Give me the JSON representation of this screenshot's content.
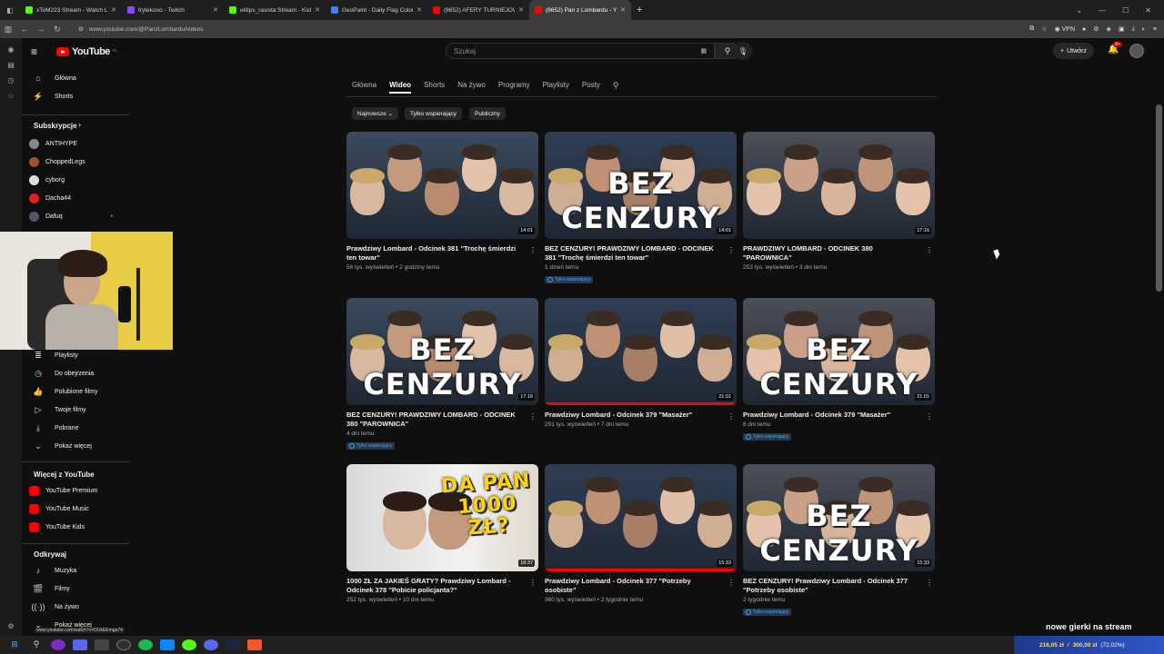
{
  "browser": {
    "tabs": [
      {
        "title": "xToM223 Stream - Watch Li",
        "color": "#53fc18",
        "active": false
      },
      {
        "title": "frytekooo - Twitch",
        "color": "#9146ff",
        "active": false
      },
      {
        "title": "eklips_rasista Stream - Kick",
        "color": "#53fc18",
        "active": false
      },
      {
        "title": "GeoPaint - Daily Flag Color Ga",
        "color": "#3b82f6",
        "active": false
      },
      {
        "title": "(8652) AFERY TURNIEJOWE! M",
        "color": "#ff0000",
        "active": false
      },
      {
        "title": "(8652) Pan z Lombardu - YouTu",
        "color": "#ff0000",
        "active": true
      }
    ],
    "new_tab": "+",
    "url": "www.youtube.com/@PanzLombardu/videos",
    "vpn_label": "VPN"
  },
  "youtube": {
    "logo_text": "YouTube",
    "logo_suffix": "PL",
    "search_placeholder": "Szukaj",
    "create_label": "Utwórz",
    "notif_count": "9+",
    "sidebar": {
      "main": [
        {
          "label": "Główna",
          "icon": "home-icon"
        },
        {
          "label": "Shorts",
          "icon": "shorts-icon"
        }
      ],
      "subs_header": "Subskrypcje",
      "subs": [
        {
          "label": "ANTIHYPE",
          "color": "#888888"
        },
        {
          "label": "ChoppedLegs",
          "color": "#a0522d"
        },
        {
          "label": "cyborg",
          "color": "#dddddd"
        },
        {
          "label": "Dacha44",
          "color": "#d22"
        },
        {
          "label": "Dafuq",
          "color": "#556"
        }
      ],
      "you": [
        {
          "label": "Playlisty",
          "icon": "playlist-icon"
        },
        {
          "label": "Do obejrzenia",
          "icon": "clock-icon"
        },
        {
          "label": "Polubione filmy",
          "icon": "thumb-up-icon"
        },
        {
          "label": "Twoje filmy",
          "icon": "video-icon"
        },
        {
          "label": "Pobrane",
          "icon": "download-icon"
        },
        {
          "label": "Pokaż więcej",
          "icon": "chevron-down-icon"
        }
      ],
      "more_header": "Więcej z YouTube",
      "more": [
        {
          "label": "YouTube Premium",
          "color": "#ff0000"
        },
        {
          "label": "YouTube Music",
          "color": "#ff0000"
        },
        {
          "label": "YouTube Kids",
          "color": "#ff0000"
        }
      ],
      "explore_header": "Odkrywaj",
      "explore": [
        {
          "label": "Muzyka",
          "icon": "music-icon"
        },
        {
          "label": "Filmy",
          "icon": "film-icon"
        },
        {
          "label": "Na żywo",
          "icon": "live-icon"
        },
        {
          "label": "Pokaż więcej",
          "icon": "chevron-down-icon"
        }
      ],
      "url_tooltip": "www.youtube.com/watch?v=DUkEEmga74"
    },
    "channel_tabs": [
      "Główna",
      "Wideo",
      "Shorts",
      "Na żywo",
      "Programy",
      "Playlisty",
      "Posty"
    ],
    "active_tab": "Wideo",
    "chips": [
      "Najnowsze",
      "Tylko wspierający",
      "Publiczny"
    ],
    "member_badge": "Tylko wspierający",
    "videos": [
      {
        "title": "Prawdziwy Lombard - Odcinek 381 \"Trochę śmierdzi ten towar\"",
        "meta": "56 tys. wyświetleń • 2 godziny temu",
        "duration": "14:01",
        "members": false,
        "overlay": "",
        "progress": 0
      },
      {
        "title": "BEZ CENZURY! PRAWDZIWY LOMBARD - ODCINEK 381 \"Trochę śmierdzi ten towar\"",
        "meta": "1 dzień temu",
        "duration": "14:01",
        "members": true,
        "overlay": "BEZ CENZURY",
        "progress": 0
      },
      {
        "title": "PRAWDZIWY LOMBARD - ODCINEK 380 \"PAROWNICA\"",
        "meta": "253 tys. wyświetleń • 3 dni temu",
        "duration": "17:16",
        "members": false,
        "overlay": "",
        "progress": 0
      },
      {
        "title": "BEZ CENZURY! PRAWDZIWY LOMBARD - ODCINEK 380 \"PAROWNICA\"",
        "meta": "4 dni temu",
        "duration": "17:16",
        "members": true,
        "overlay": "BEZ CENZURY",
        "progress": 0
      },
      {
        "title": "Prawdziwy Lombard - Odcinek 379 \"Masażer\"",
        "meta": "291 tys. wyświetleń • 7 dni temu",
        "duration": "21:01",
        "members": false,
        "overlay": "",
        "progress": 1.0
      },
      {
        "title": "Prawdziwy Lombard - Odcinek 379 \"Masażer\"",
        "meta": "8 dni temu",
        "duration": "21:01",
        "members": true,
        "overlay": "BEZ CENZURY",
        "progress": 0
      },
      {
        "title": "1000 ZŁ ZA JAKIEŚ GRATY? Prawdziwy Lombard - Odcinek 378 \"Pobicie policjanta?\"",
        "meta": "252 tys. wyświetleń • 10 dni temu",
        "duration": "18:37",
        "members": false,
        "overlay": "DA PAN 1000 ZŁ?",
        "progress": 0
      },
      {
        "title": "Prawdziwy Lombard - Odcinek 377 \"Potrzeby osobiste\"",
        "meta": "360 tys. wyświetleń • 2 tygodnie temu",
        "duration": "15:33",
        "members": false,
        "overlay": "",
        "progress": 1.0
      },
      {
        "title": "BEZ CENZURY! Prawdziwy Lombard - Odcinek 377 \"Potrzeby osobiste\"",
        "meta": "2 tygodnie temu",
        "duration": "15:33",
        "members": true,
        "overlay": "BEZ CENZURY",
        "progress": 0
      }
    ]
  },
  "stream_overlay": "nowe gierki na stream",
  "tray": {
    "amount": "216,05 zł",
    "goal": "300,00 zł",
    "extra": "(72,02%)"
  }
}
